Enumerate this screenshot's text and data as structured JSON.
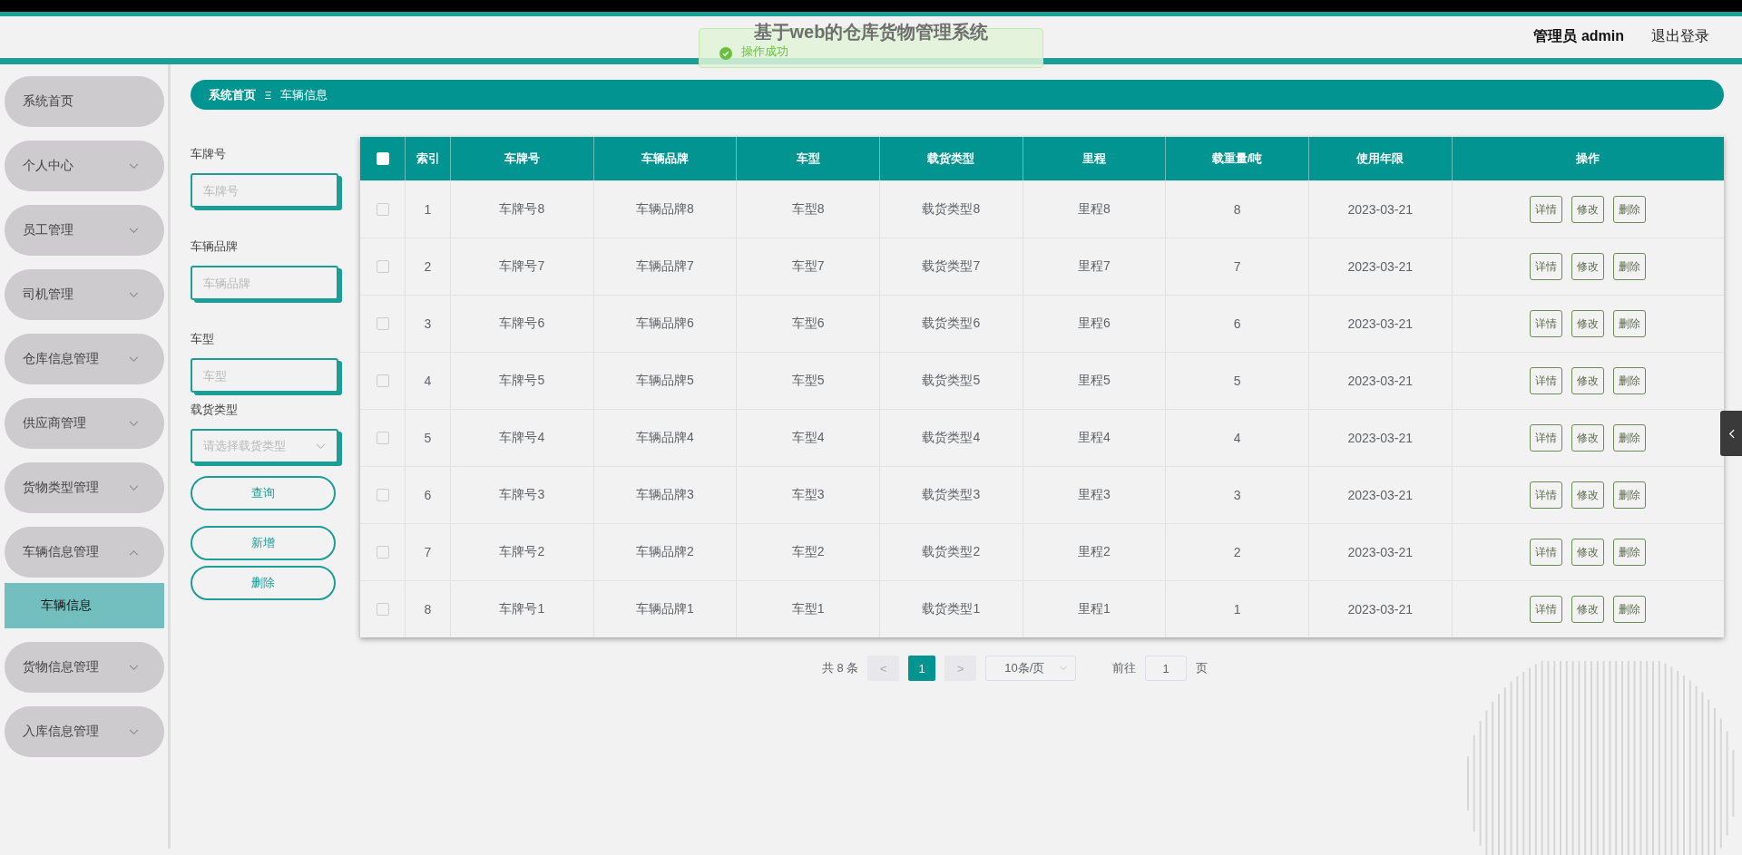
{
  "header": {
    "title": "基于web的仓库货物管理系统",
    "user": "管理员 admin",
    "logout": "退出登录"
  },
  "toast": {
    "message": "操作成功"
  },
  "sidebar": {
    "items": [
      {
        "label": "系统首页",
        "kind": "link"
      },
      {
        "label": "个人中心",
        "kind": "menu",
        "expanded": false
      },
      {
        "label": "员工管理",
        "kind": "menu",
        "expanded": false
      },
      {
        "label": "司机管理",
        "kind": "menu",
        "expanded": false
      },
      {
        "label": "仓库信息管理",
        "kind": "menu",
        "expanded": false
      },
      {
        "label": "供应商管理",
        "kind": "menu",
        "expanded": false
      },
      {
        "label": "货物类型管理",
        "kind": "menu",
        "expanded": false
      },
      {
        "label": "车辆信息管理",
        "kind": "menu",
        "expanded": true,
        "children": [
          {
            "label": "车辆信息",
            "selected": true
          }
        ]
      },
      {
        "label": "货物信息管理",
        "kind": "menu",
        "expanded": false
      },
      {
        "label": "入库信息管理",
        "kind": "menu",
        "expanded": false
      }
    ]
  },
  "breadcrumb": [
    "系统首页",
    "车辆信息"
  ],
  "search": {
    "fields": [
      {
        "label": "车牌号",
        "placeholder": "车牌号",
        "kind": "input"
      },
      {
        "label": "车辆品牌",
        "placeholder": "车辆品牌",
        "kind": "input"
      },
      {
        "label": "车型",
        "placeholder": "车型",
        "kind": "input"
      },
      {
        "label": "载货类型",
        "placeholder": "请选择载货类型",
        "kind": "select"
      }
    ],
    "buttons": [
      "查询",
      "新增",
      "删除"
    ]
  },
  "table": {
    "header_checked": false,
    "columns": [
      "索引",
      "车牌号",
      "车辆品牌",
      "车型",
      "载货类型",
      "里程",
      "载重量/吨",
      "使用年限",
      "操作"
    ],
    "rows": [
      {
        "checked": false,
        "cells": [
          "1",
          "车牌号8",
          "车辆品牌8",
          "车型8",
          "载货类型8",
          "里程8",
          "8",
          "2023-03-21"
        ],
        "actions": [
          "详情",
          "修改",
          "删除"
        ]
      },
      {
        "checked": false,
        "cells": [
          "2",
          "车牌号7",
          "车辆品牌7",
          "车型7",
          "载货类型7",
          "里程7",
          "7",
          "2023-03-21"
        ],
        "actions": [
          "详情",
          "修改",
          "删除"
        ]
      },
      {
        "checked": false,
        "cells": [
          "3",
          "车牌号6",
          "车辆品牌6",
          "车型6",
          "载货类型6",
          "里程6",
          "6",
          "2023-03-21"
        ],
        "actions": [
          "详情",
          "修改",
          "删除"
        ]
      },
      {
        "checked": false,
        "cells": [
          "4",
          "车牌号5",
          "车辆品牌5",
          "车型5",
          "载货类型5",
          "里程5",
          "5",
          "2023-03-21"
        ],
        "actions": [
          "详情",
          "修改",
          "删除"
        ]
      },
      {
        "checked": false,
        "cells": [
          "5",
          "车牌号4",
          "车辆品牌4",
          "车型4",
          "载货类型4",
          "里程4",
          "4",
          "2023-03-21"
        ],
        "actions": [
          "详情",
          "修改",
          "删除"
        ]
      },
      {
        "checked": false,
        "cells": [
          "6",
          "车牌号3",
          "车辆品牌3",
          "车型3",
          "载货类型3",
          "里程3",
          "3",
          "2023-03-21"
        ],
        "actions": [
          "详情",
          "修改",
          "删除"
        ]
      },
      {
        "checked": false,
        "cells": [
          "7",
          "车牌号2",
          "车辆品牌2",
          "车型2",
          "载货类型2",
          "里程2",
          "2",
          "2023-03-21"
        ],
        "actions": [
          "详情",
          "修改",
          "删除"
        ]
      },
      {
        "checked": false,
        "cells": [
          "8",
          "车牌号1",
          "车辆品牌1",
          "车型1",
          "载货类型1",
          "里程1",
          "1",
          "2023-03-21"
        ],
        "actions": [
          "详情",
          "修改",
          "删除"
        ]
      }
    ]
  },
  "pagination": {
    "total": "共 8 条",
    "prev": "<",
    "pages": [
      {
        "label": "1",
        "selected": true
      }
    ],
    "next": ">",
    "page_size": "10条/页",
    "goto_label": "前往",
    "goto_value": "1",
    "goto_suffix": "页"
  }
}
